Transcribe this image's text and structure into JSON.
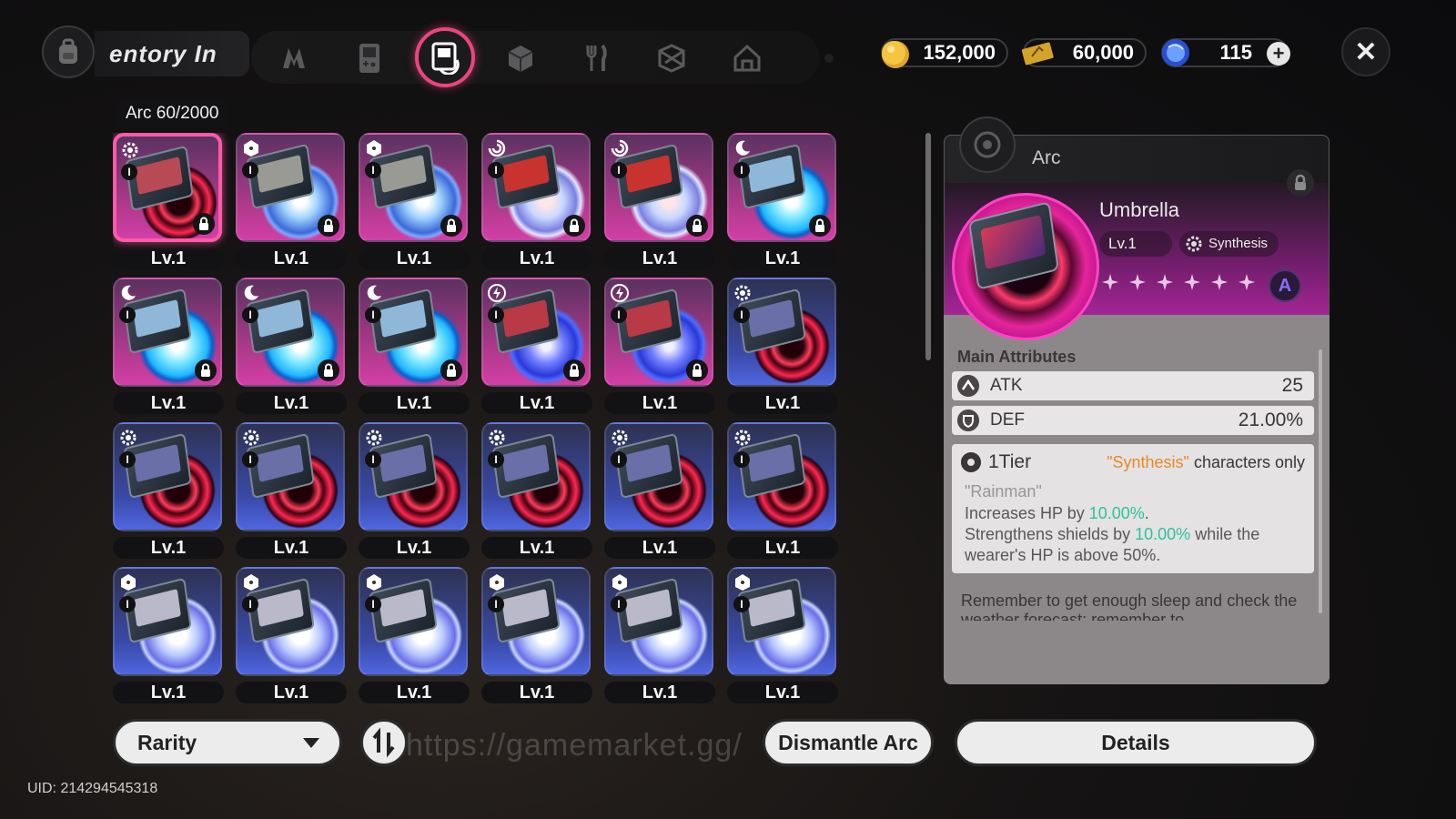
{
  "header": {
    "title_text": "entory  In",
    "nav_tabs": [
      {
        "icon": "n-logo-icon",
        "active": false
      },
      {
        "icon": "gameboy-icon",
        "active": false
      },
      {
        "icon": "arc-disc-icon",
        "active": true
      },
      {
        "icon": "cube-icon",
        "active": false
      },
      {
        "icon": "utensils-icon",
        "active": false
      },
      {
        "icon": "package-icon",
        "active": false
      },
      {
        "icon": "home-icon",
        "active": false
      }
    ]
  },
  "currencies": {
    "gold": "152,000",
    "tickets": "60,000",
    "crystals": "115"
  },
  "inventory": {
    "count_label": "Arc 60/2000",
    "items": [
      {
        "level": "Lv.1",
        "frame": "purple",
        "disc": "red",
        "art": "#b84a56",
        "element": "gear",
        "locked": true,
        "selected": true
      },
      {
        "level": "Lv.1",
        "frame": "purple",
        "disc": "light",
        "art": "#9a9a94",
        "element": "dice",
        "locked": true,
        "selected": false
      },
      {
        "level": "Lv.1",
        "frame": "purple",
        "disc": "light",
        "art": "#9a9a94",
        "element": "dice",
        "locked": true,
        "selected": false
      },
      {
        "level": "Lv.1",
        "frame": "purple",
        "disc": "storm",
        "art": "#c8332f",
        "element": "swirl",
        "locked": true,
        "selected": false
      },
      {
        "level": "Lv.1",
        "frame": "purple",
        "disc": "storm",
        "art": "#c8332f",
        "element": "swirl",
        "locked": true,
        "selected": false
      },
      {
        "level": "Lv.1",
        "frame": "purple",
        "disc": "cyan",
        "art": "#8fb7d8",
        "element": "moon",
        "locked": true,
        "selected": false
      },
      {
        "level": "Lv.1",
        "frame": "purple",
        "disc": "cyan",
        "art": "#8fb7d8",
        "element": "moon",
        "locked": true,
        "selected": false
      },
      {
        "level": "Lv.1",
        "frame": "purple",
        "disc": "cyan",
        "art": "#8fb7d8",
        "element": "moon",
        "locked": true,
        "selected": false
      },
      {
        "level": "Lv.1",
        "frame": "purple",
        "disc": "cyan",
        "art": "#8fb7d8",
        "element": "moon",
        "locked": true,
        "selected": false
      },
      {
        "level": "Lv.1",
        "frame": "purple",
        "disc": "elec",
        "art": "#b83a46",
        "element": "bolt",
        "locked": true,
        "selected": false
      },
      {
        "level": "Lv.1",
        "frame": "purple",
        "disc": "elec",
        "art": "#b83a46",
        "element": "bolt",
        "locked": true,
        "selected": false
      },
      {
        "level": "Lv.1",
        "frame": "blue",
        "disc": "red",
        "art": "#6a6fa8",
        "element": "gear",
        "locked": false,
        "selected": false
      },
      {
        "level": "Lv.1",
        "frame": "blue",
        "disc": "red",
        "art": "#6a6fa8",
        "element": "gear",
        "locked": false,
        "selected": false
      },
      {
        "level": "Lv.1",
        "frame": "blue",
        "disc": "red",
        "art": "#6a6fa8",
        "element": "gear",
        "locked": false,
        "selected": false
      },
      {
        "level": "Lv.1",
        "frame": "blue",
        "disc": "red",
        "art": "#6a6fa8",
        "element": "gear",
        "locked": false,
        "selected": false
      },
      {
        "level": "Lv.1",
        "frame": "blue",
        "disc": "red",
        "art": "#6a6fa8",
        "element": "gear",
        "locked": false,
        "selected": false
      },
      {
        "level": "Lv.1",
        "frame": "blue",
        "disc": "red",
        "art": "#6a6fa8",
        "element": "gear",
        "locked": false,
        "selected": false
      },
      {
        "level": "Lv.1",
        "frame": "blue",
        "disc": "red",
        "art": "#6a6fa8",
        "element": "gear",
        "locked": false,
        "selected": false
      },
      {
        "level": "Lv.1",
        "frame": "blue",
        "disc": "pale",
        "art": "#b9b9c9",
        "element": "dice",
        "locked": false,
        "selected": false
      },
      {
        "level": "Lv.1",
        "frame": "blue",
        "disc": "pale",
        "art": "#b9b9c9",
        "element": "dice",
        "locked": false,
        "selected": false
      },
      {
        "level": "Lv.1",
        "frame": "blue",
        "disc": "pale",
        "art": "#b9b9c9",
        "element": "dice",
        "locked": false,
        "selected": false
      },
      {
        "level": "Lv.1",
        "frame": "blue",
        "disc": "pale",
        "art": "#b9b9c9",
        "element": "dice",
        "locked": false,
        "selected": false
      },
      {
        "level": "Lv.1",
        "frame": "blue",
        "disc": "pale",
        "art": "#b9b9c9",
        "element": "dice",
        "locked": false,
        "selected": false
      },
      {
        "level": "Lv.1",
        "frame": "blue",
        "disc": "pale",
        "art": "#b9b9c9",
        "element": "dice",
        "locked": false,
        "selected": false
      }
    ],
    "tier_pip": "I"
  },
  "detail": {
    "category": "Arc",
    "name": "Umbrella",
    "level": "Lv.1",
    "tag": "Synthesis",
    "stars": 6,
    "rank": "A",
    "main_attributes_title": "Main Attributes",
    "attributes": [
      {
        "label": "ATK",
        "value": "25",
        "icon": "atk-icon"
      },
      {
        "label": "DEF",
        "value": "21.00%",
        "icon": "shield-icon"
      }
    ],
    "tier": {
      "label": "1Tier",
      "req_prefix": "\"Synthesis\"",
      "req_suffix": " characters only",
      "quote": "\"Rainman\"",
      "line1_prefix": "Increases HP by ",
      "line1_value": "10.00%",
      "line1_suffix": ".",
      "line2_prefix": "Strengthens shields by ",
      "line2_value": "10.00%",
      "line2_suffix": " while the",
      "line3": "wearer's HP is above 50%."
    },
    "flavor": "Remember to get enough sleep and check the weather forecast; remember to"
  },
  "bottom": {
    "rarity_label": "Rarity",
    "dismantle_label": "Dismantle Arc",
    "details_label": "Details",
    "watermark": "https://gamemarket.gg/",
    "uid": "UID: 214294545318"
  }
}
